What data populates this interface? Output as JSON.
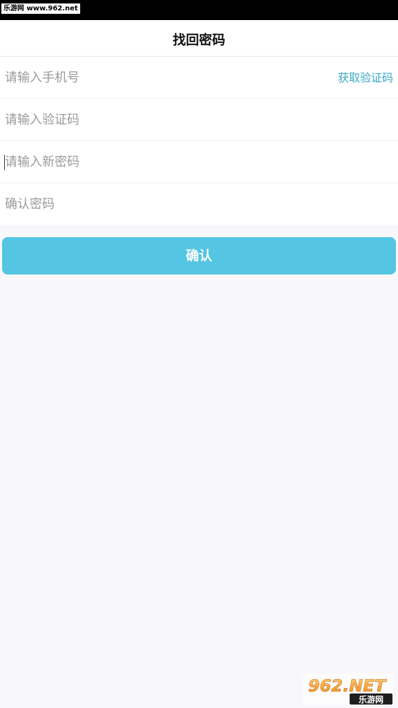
{
  "status_bar": {
    "watermark_text": "乐游网 www.962.net"
  },
  "header": {
    "title": "找回密码"
  },
  "form": {
    "phone_placeholder": "请输入手机号",
    "get_code_label": "获取验证码",
    "code_placeholder": "请输入验证码",
    "new_password_placeholder": "请输入新密码",
    "confirm_password_placeholder": "确认密码"
  },
  "actions": {
    "confirm_label": "确认"
  },
  "watermark_logo": {
    "text": "962.NET",
    "subtext": "乐游网"
  },
  "colors": {
    "accent": "#54c5e3",
    "link": "#3aa8c6",
    "background": "#f8f8fa"
  }
}
